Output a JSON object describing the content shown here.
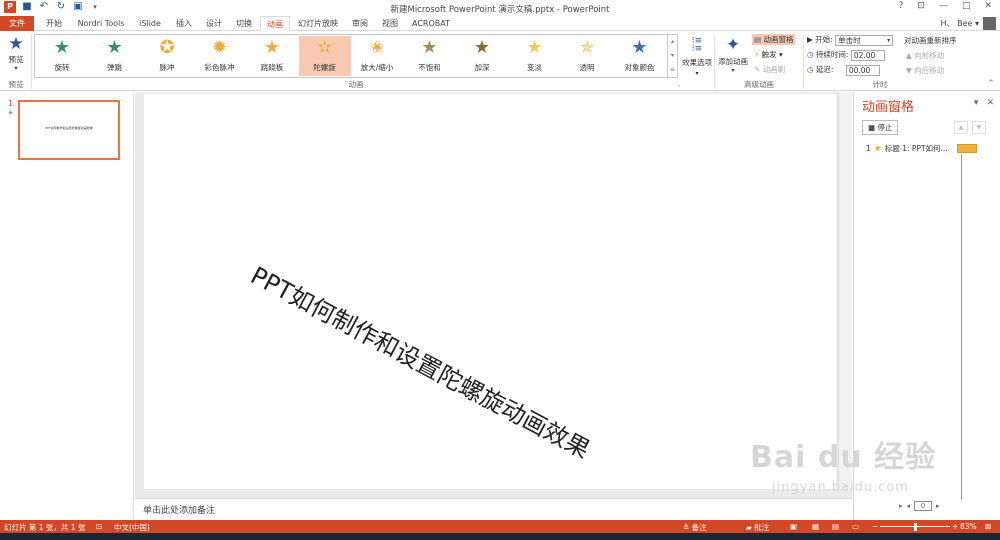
{
  "window": {
    "title": "新建Microsoft PowerPoint 演示文稿.pptx - PowerPoint",
    "controls": [
      "?",
      "⊡",
      "—",
      "□",
      "✕"
    ]
  },
  "qat": {
    "icons": [
      "powerpoint-logo-icon",
      "save-icon",
      "undo-icon",
      "redo-icon",
      "present-icon",
      "customize-icon"
    ]
  },
  "tabs": [
    {
      "label": "文件"
    },
    {
      "label": "开始"
    },
    {
      "label": "Nordri Tools"
    },
    {
      "label": "iSlide"
    },
    {
      "label": "插入"
    },
    {
      "label": "设计"
    },
    {
      "label": "切换"
    },
    {
      "label": "动画"
    },
    {
      "label": "幻灯片放映"
    },
    {
      "label": "审阅"
    },
    {
      "label": "视图"
    },
    {
      "label": "ACROBAT"
    }
  ],
  "user": {
    "name": "H、 Bee ▾"
  },
  "ribbon": {
    "preview": {
      "label": "预览",
      "group": "预览"
    },
    "animations": {
      "group": "动画",
      "items": [
        {
          "label": "旋转",
          "color": "#3c8c74",
          "glyph": "★"
        },
        {
          "label": "弹跳",
          "color": "#3c8c74",
          "glyph": "★"
        },
        {
          "label": "脉冲",
          "color": "#e8b03a",
          "glyph": "✪"
        },
        {
          "label": "彩色脉冲",
          "color": "#e8b03a",
          "glyph": "✹"
        },
        {
          "label": "跷跷板",
          "color": "#e8b03a",
          "glyph": "★"
        },
        {
          "label": "陀螺旋",
          "color": "#e8b03a",
          "glyph": "✫"
        },
        {
          "label": "放大/缩小",
          "color": "#e8b03a",
          "glyph": "✬"
        },
        {
          "label": "不饱和",
          "color": "#a7895c",
          "glyph": "★"
        },
        {
          "label": "加深",
          "color": "#8a6a2c",
          "glyph": "★"
        },
        {
          "label": "变淡",
          "color": "#f0c860",
          "glyph": "★"
        },
        {
          "label": "透明",
          "color": "#f0c860",
          "glyph": "✯"
        },
        {
          "label": "对象颜色",
          "color": "#3c6fb8",
          "glyph": "★"
        }
      ],
      "selected_index": 5
    },
    "effect_options": {
      "label": "效果选项"
    },
    "advanced": {
      "group": "高级动画",
      "add_animation": "添加动画",
      "animation_pane": "动画窗格",
      "trigger": "触发 ▾",
      "animation_painter": "动画刷"
    },
    "timing": {
      "group": "计时",
      "start_label": "▶ 开始:",
      "start_value": "单击时",
      "duration_label": "持续时间:",
      "duration_value": "02.00",
      "delay_label": "延迟:",
      "delay_value": "00.00",
      "reorder_title": "对动画重新排序",
      "move_earlier": "▲ 向前移动",
      "move_later": "▼ 向后移动"
    }
  },
  "slides_panel": {
    "slide_number": "1",
    "star_marker": "✳",
    "thumb_text": "PPT如何制作和设置陀螺旋动画效果"
  },
  "slide": {
    "text": "PPT如何制作和设置陀螺旋动画效果"
  },
  "notes": {
    "placeholder": "单击此处添加备注"
  },
  "animation_pane": {
    "title": "动画窗格",
    "play_label": "停止",
    "item_number": "1",
    "item_label": "标题 1: PPT如何...",
    "bottom_value": "0"
  },
  "statusbar": {
    "slide_info": "幻灯片 第 1 张，共 1 张",
    "language": "中文(中国)",
    "notes_label": "备注",
    "comments_label": "批注",
    "zoom": "83%",
    "zoom_level": 0.5
  },
  "watermark": {
    "main": "Bai du 经验",
    "url": "jingyan.baidu.com"
  },
  "colors": {
    "accent": "#d24726",
    "selected_animation": "#f9c8b0",
    "timeline_bar": "#f0b23f"
  }
}
